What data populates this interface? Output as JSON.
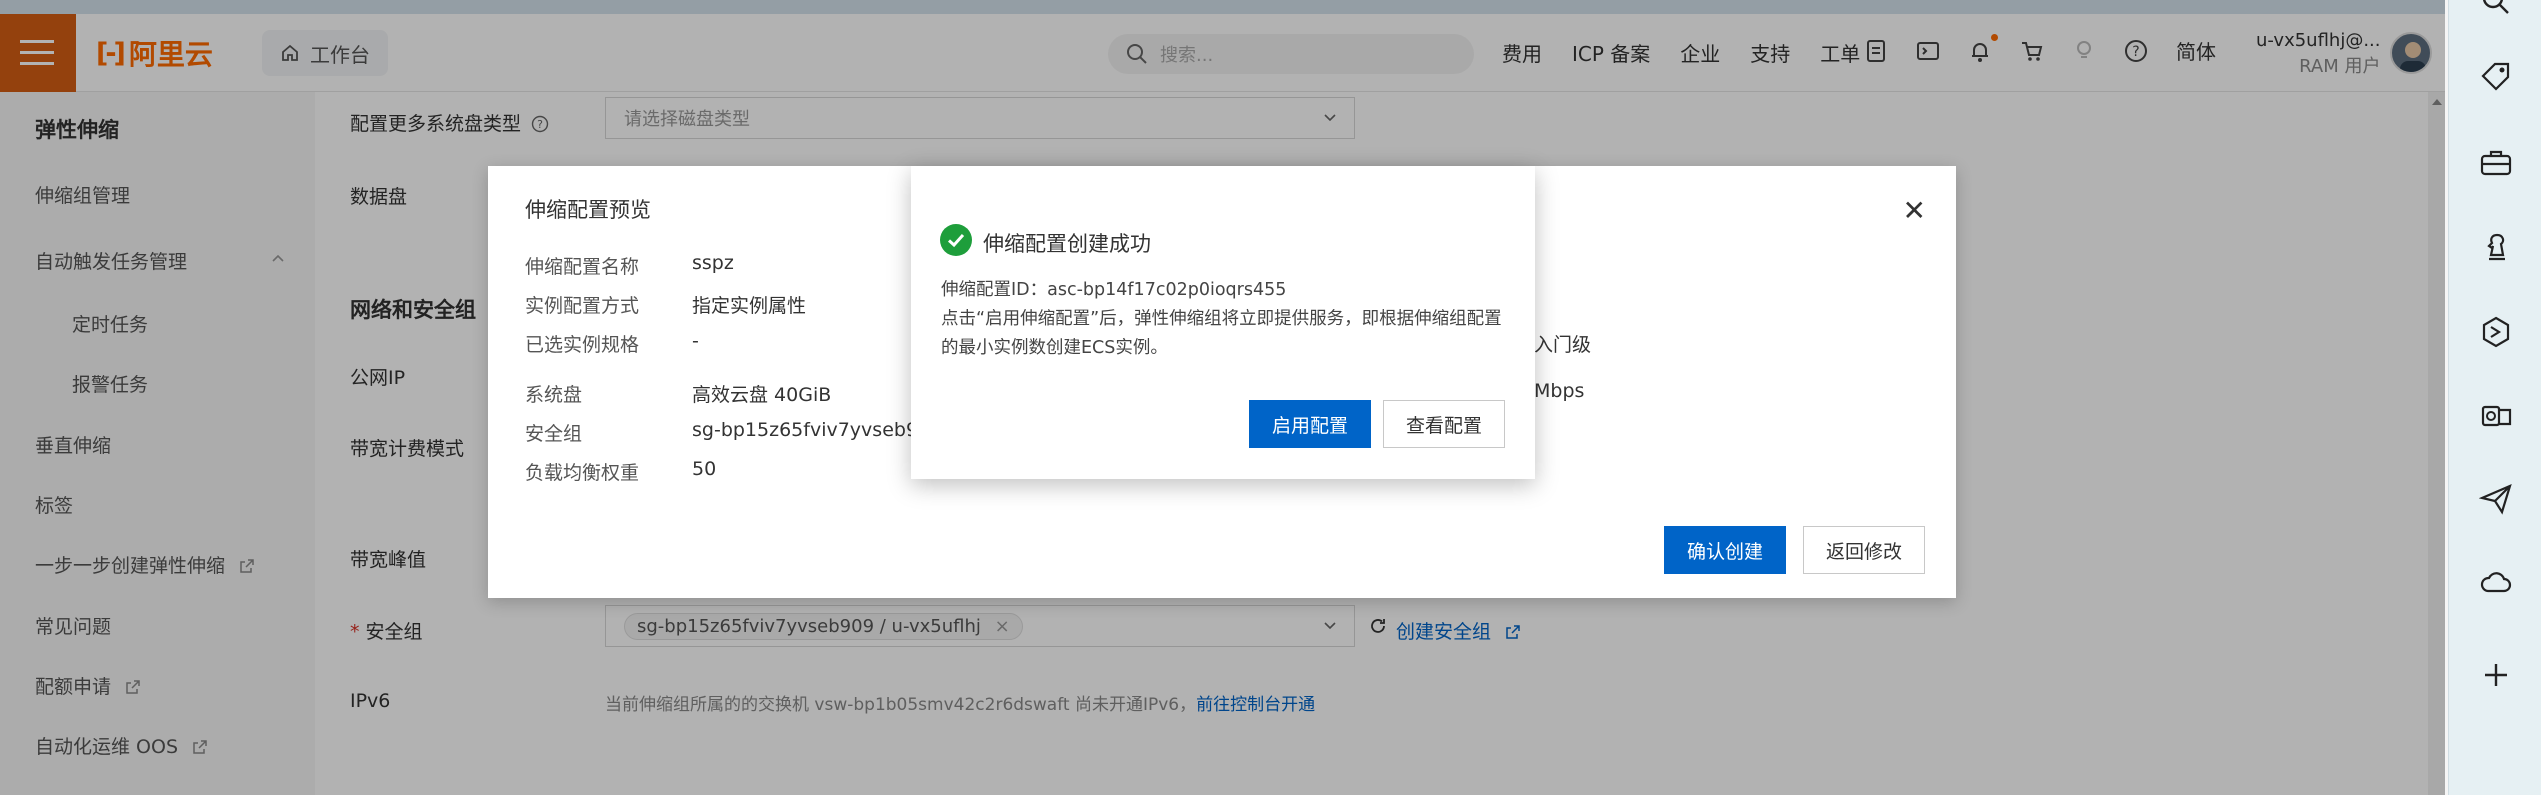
{
  "header": {
    "logo_text": "阿里云",
    "console_label": "工作台",
    "search_placeholder": "搜索...",
    "nav": [
      "费用",
      "ICP 备案",
      "企业",
      "支持",
      "工单"
    ],
    "language": "简体",
    "user_name": "u-vx5uflhj@...",
    "user_role": "RAM 用户"
  },
  "sidebar": {
    "title": "弹性伸缩",
    "items": [
      "伸缩组管理",
      "自动触发任务管理",
      "定时任务",
      "报警任务",
      "垂直伸缩",
      "标签",
      "一步一步创建弹性伸缩",
      "常见问题",
      "配额申请",
      "自动化运维 OOS"
    ]
  },
  "form": {
    "more_disk_label": "配置更多系统盘类型",
    "disk_type_placeholder": "请选择磁盘类型",
    "data_disk_label": "数据盘",
    "network_section": "网络和安全组",
    "public_ip_label": "公网IP",
    "bandwidth_billing_label": "带宽计费模式",
    "bandwidth_peak_label": "带宽峰值",
    "security_group_label": "安全组",
    "security_group_required": "*",
    "security_group_tag": "sg-bp15z65fviv7yvseb909 / u-vx5uflhj",
    "create_sg_link": "创建安全组",
    "ipv6_label": "IPv6",
    "ipv6_text": "当前伸缩组所属的的交换机 vsw-bp1b05smv42c2r6dswaft 尚未开通IPv6，",
    "ipv6_link": "前往控制台开通"
  },
  "preview_dialog": {
    "title": "伸缩配置预览",
    "rows": [
      {
        "label": "伸缩配置名称",
        "value": "sspz"
      },
      {
        "label": "实例配置方式",
        "value": "指定实例属性"
      },
      {
        "label": "已选实例规格",
        "value": "-"
      },
      {
        "label": "系统盘",
        "value": "高效云盘 40GiB"
      },
      {
        "label": "安全组",
        "value": "sg-bp15z65fviv7yvseb909"
      },
      {
        "label": "负载均衡权重",
        "value": "50"
      }
    ],
    "right_fragment_1": "入门级",
    "right_fragment_2": "Mbps",
    "confirm_button": "确认创建",
    "back_button": "返回修改"
  },
  "success_dialog": {
    "title": "伸缩配置创建成功",
    "config_id_line": "伸缩配置ID：asc-bp14f17c02p0ioqrs455",
    "description": "点击“启用伸缩配置”后，弹性伸缩组将立即提供服务，即根据伸缩组配置的最小实例数创建ECS实例。",
    "enable_button": "启用配置",
    "view_button": "查看配置"
  },
  "colors": {
    "brand": "#ff6a00",
    "primary": "#0064c8",
    "success": "#1e9e3b"
  }
}
